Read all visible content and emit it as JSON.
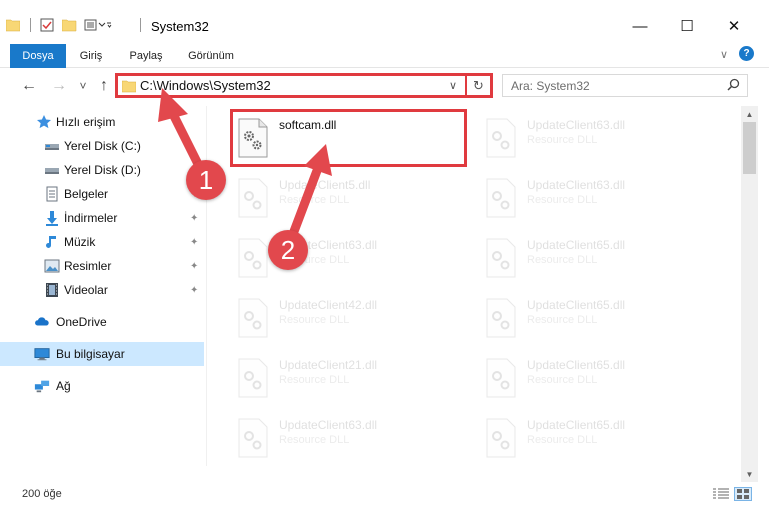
{
  "window": {
    "title": "System32",
    "minimize_glyph": "—",
    "maximize_glyph": "☐",
    "close_glyph": "✕"
  },
  "ribbon": {
    "tabs": [
      {
        "label": "Dosya",
        "active": true
      },
      {
        "label": "Giriş",
        "active": false
      },
      {
        "label": "Paylaş",
        "active": false
      },
      {
        "label": "Görünüm",
        "active": false
      }
    ],
    "expand_glyph": "∨",
    "help_glyph": "?"
  },
  "navigation": {
    "back_glyph": "←",
    "forward_glyph": "→",
    "recent_glyph": "˅",
    "up_glyph": "↑",
    "address": "C:\\Windows\\System32",
    "address_dropdown_glyph": "∨",
    "refresh_glyph": "↻",
    "search_placeholder": "Ara: System32",
    "search_glyph": "⌕"
  },
  "sidebar": {
    "items": [
      {
        "label": "Hızlı erişim",
        "icon": "star-icon",
        "pinned": false
      },
      {
        "label": "Yerel Disk (C:)",
        "icon": "drive-c-icon",
        "pinned": false
      },
      {
        "label": "Yerel Disk (D:)",
        "icon": "drive-d-icon",
        "pinned": false
      },
      {
        "label": "Belgeler",
        "icon": "documents-icon",
        "pinned": true
      },
      {
        "label": "İndirmeler",
        "icon": "downloads-icon",
        "pinned": true
      },
      {
        "label": "Müzik",
        "icon": "music-icon",
        "pinned": true
      },
      {
        "label": "Resimler",
        "icon": "pictures-icon",
        "pinned": true
      },
      {
        "label": "Videolar",
        "icon": "videos-icon",
        "pinned": true
      },
      {
        "label": "OneDrive",
        "icon": "onedrive-icon",
        "pinned": false
      },
      {
        "label": "Bu bilgisayar",
        "icon": "this-pc-icon",
        "pinned": false,
        "selected": true
      },
      {
        "label": "Ağ",
        "icon": "network-icon",
        "pinned": false
      }
    ],
    "pin_glyph": "✦"
  },
  "files": [
    {
      "name": "softcam.dll",
      "type": "",
      "highlighted": true
    },
    {
      "name": "UpdateClient63.dll",
      "type": "Resource DLL",
      "highlighted": false
    },
    {
      "name": "UpdateClient5.dll",
      "type": "Resource DLL",
      "highlighted": false
    },
    {
      "name": "UpdateClient63.dll",
      "type": "Resource DLL",
      "highlighted": false
    },
    {
      "name": "UpdateClient63.dll",
      "type": "Resource DLL",
      "highlighted": false
    },
    {
      "name": "UpdateClient65.dll",
      "type": "Resource DLL",
      "highlighted": false
    },
    {
      "name": "UpdateClient42.dll",
      "type": "Resource DLL",
      "highlighted": false
    },
    {
      "name": "UpdateClient65.dll",
      "type": "Resource DLL",
      "highlighted": false
    },
    {
      "name": "UpdateClient21.dll",
      "type": "Resource DLL",
      "highlighted": false
    },
    {
      "name": "UpdateClient65.dll",
      "type": "Resource DLL",
      "highlighted": false
    },
    {
      "name": "UpdateClient63.dll",
      "type": "Resource DLL",
      "highlighted": false
    },
    {
      "name": "UpdateClient65.dll",
      "type": "Resource DLL",
      "highlighted": false
    }
  ],
  "annotations": {
    "step1": "1",
    "step2": "2",
    "color": "#e2484d"
  },
  "status": {
    "count": "200 öğe"
  },
  "colors": {
    "accent": "#1979ca",
    "selected": "#cce8ff",
    "highlight": "#e03a3f"
  }
}
